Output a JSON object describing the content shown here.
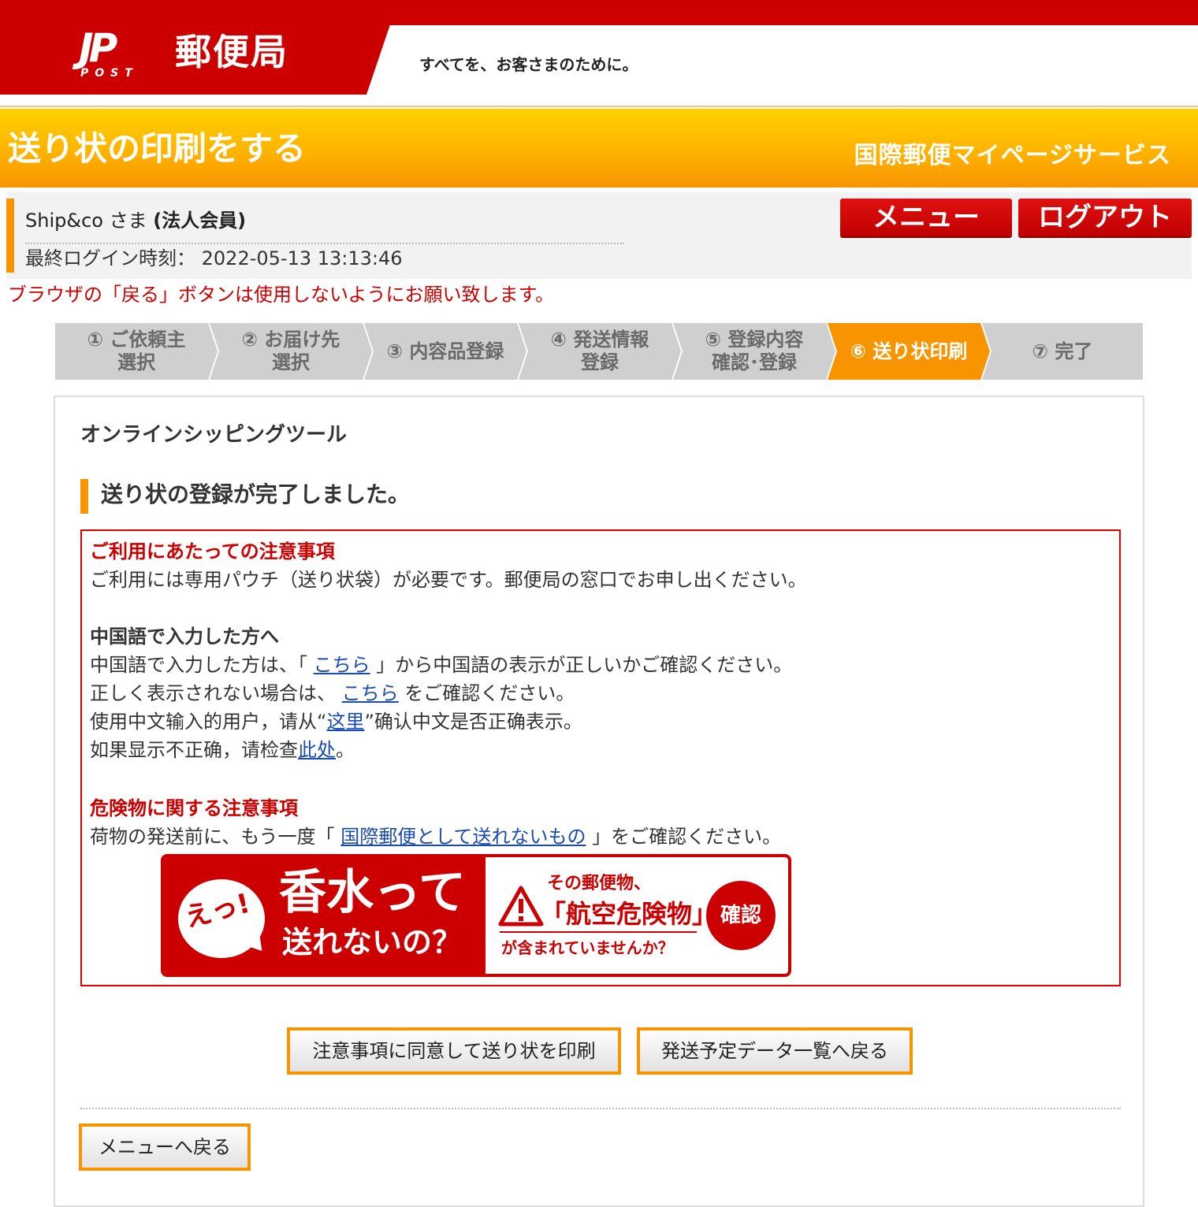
{
  "header": {
    "logo_text": "JP",
    "logo_sub": "POST",
    "brand": "郵便局",
    "slogan": "すべてを、お客さまのために。",
    "page_title": "送り状の印刷をする",
    "service_name": "国際郵便マイページサービス"
  },
  "user": {
    "name": "Ship&co さま",
    "member_type": "(法人会員)",
    "last_login_label": "最終ログイン時刻：",
    "last_login_value": "2022-05-13 13:13:46"
  },
  "nav": {
    "menu_label": "メニュー",
    "logout_label": "ログアウト"
  },
  "browser_warning": "ブラウザの「戻る」ボタンは使用しないようにお願い致します。",
  "steps": [
    {
      "label": "① ご依頼主\n選択",
      "active": false
    },
    {
      "label": "② お届け先\n選択",
      "active": false
    },
    {
      "label": "③ 内容品登録",
      "active": false
    },
    {
      "label": "④ 発送情報\n登録",
      "active": false
    },
    {
      "label": "⑤ 登録内容\n確認･登録",
      "active": false
    },
    {
      "label": "⑥ 送り状印刷",
      "active": true
    },
    {
      "label": "⑦ 完了",
      "active": false
    }
  ],
  "main": {
    "tool_title": "オンラインシッピングツール",
    "completed_heading": "送り状の登録が完了しました。"
  },
  "notice": {
    "usage_heading": "ご利用にあたっての注意事項",
    "usage_text": "ご利用には専用パウチ（送り状袋）が必要です。郵便局の窓口でお申し出ください。",
    "chinese_heading": "中国語で入力した方へ",
    "chinese_line1_pre": "中国語で入力した方は、「 ",
    "chinese_line1_link": "こちら",
    "chinese_line1_post": " 」から中国語の表示が正しいかご確認ください。",
    "chinese_line2_pre": "正しく表示されない場合は、 ",
    "chinese_line2_link": "こちら",
    "chinese_line2_post": " をご確認ください。",
    "chinese_line3_pre": "使用中文输入的用户，请从“",
    "chinese_line3_link": "这里",
    "chinese_line3_post": "”确认中文是否正确表示。",
    "chinese_line4_pre": "如果显示不正确，请检查",
    "chinese_line4_link": "此处",
    "chinese_line4_post": "。",
    "danger_heading": "危険物に関する注意事項",
    "danger_pre": "荷物の発送前に、もう一度「 ",
    "danger_link": "国際郵便として送れないもの",
    "danger_post": " 」をご確認ください。"
  },
  "banner": {
    "exclaim": "えっ!",
    "main_line1": "香水って",
    "main_line2": "送れないの？",
    "right_line1": "その郵便物、",
    "right_line2": "「航空危険物」",
    "right_line3": "が含まれていませんか？",
    "confirm": "確認"
  },
  "buttons": {
    "print": "注意事項に同意して送り状を印刷",
    "back_list": "発送予定データ一覧へ戻る",
    "menu_back": "メニューへ戻る"
  },
  "colors": {
    "brand_red": "#cc0000",
    "accent_orange": "#f79400",
    "link_blue": "#1a4bb3"
  }
}
